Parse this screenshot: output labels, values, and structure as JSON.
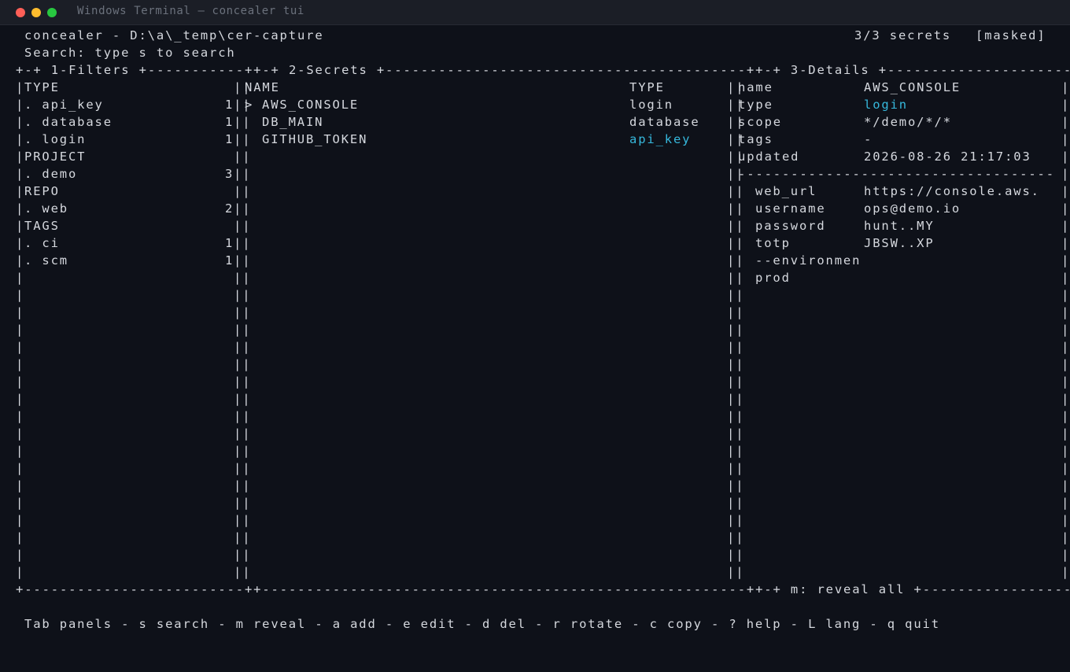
{
  "window": {
    "title": "Windows Terminal — concealer tui"
  },
  "header": {
    "app_path": "concealer - D:\\a\\_temp\\cer-capture",
    "count": "3/3 secrets",
    "mode": "[masked]",
    "search_hint": "Search: type s to search"
  },
  "panels": {
    "filters_title": "1-Filters",
    "secrets_title": "2-Secrets",
    "details_title": "3-Details",
    "bottom_hint": "m: reveal all"
  },
  "filters": {
    "groups": [
      {
        "heading": "TYPE",
        "items": [
          {
            "label": ". api_key",
            "count": "1"
          },
          {
            "label": ". database",
            "count": "1"
          },
          {
            "label": ". login",
            "count": "1"
          }
        ]
      },
      {
        "heading": "PROJECT",
        "items": [
          {
            "label": ". demo",
            "count": "3"
          }
        ]
      },
      {
        "heading": "REPO",
        "items": [
          {
            "label": ". web",
            "count": "2"
          }
        ]
      },
      {
        "heading": "TAGS",
        "items": [
          {
            "label": ". ci",
            "count": "1"
          },
          {
            "label": ". scm",
            "count": "1"
          }
        ]
      }
    ]
  },
  "secrets": {
    "columns": [
      "NAME",
      "TYPE"
    ],
    "cursor": ">",
    "rows": [
      {
        "name": "AWS_CONSOLE",
        "type": "login",
        "type_color": "#d5d8de",
        "selected": true
      },
      {
        "name": "DB_MAIN",
        "type": "database",
        "type_color": "#d5d8de",
        "selected": false
      },
      {
        "name": "GITHUB_TOKEN",
        "type": "api_key",
        "type_color": "#36b8dc",
        "selected": false
      }
    ]
  },
  "details": {
    "fields": [
      {
        "key": "name",
        "value": "AWS_CONSOLE",
        "value_color": "#d5d8de"
      },
      {
        "key": "type",
        "value": "login",
        "value_color": "#36b8dc"
      },
      {
        "key": "scope",
        "value": "*/demo/*/*",
        "value_color": "#d5d8de"
      },
      {
        "key": "tags",
        "value": "-",
        "value_color": "#d5d8de"
      },
      {
        "key": "updated",
        "value": "2026-08-26 21:17:03",
        "value_color": "#d5d8de"
      }
    ],
    "secret_fields": [
      {
        "key": "web_url",
        "value": "https://console.aws."
      },
      {
        "key": "username",
        "value": "ops@demo.io"
      },
      {
        "key": "password",
        "value": "hunt..MY"
      },
      {
        "key": "totp",
        "value": "JBSW..XP"
      },
      {
        "key": "--environmen",
        "value": ""
      },
      {
        "key": "prod",
        "value": ""
      }
    ]
  },
  "footer": {
    "help": "Tab panels - s search - m reveal - a add - e edit - d del - r rotate - c copy - ? help - L lang - q quit"
  },
  "colors": {
    "background": "#0e1119",
    "foreground": "#d5d8de",
    "accent": "#36b8dc"
  }
}
